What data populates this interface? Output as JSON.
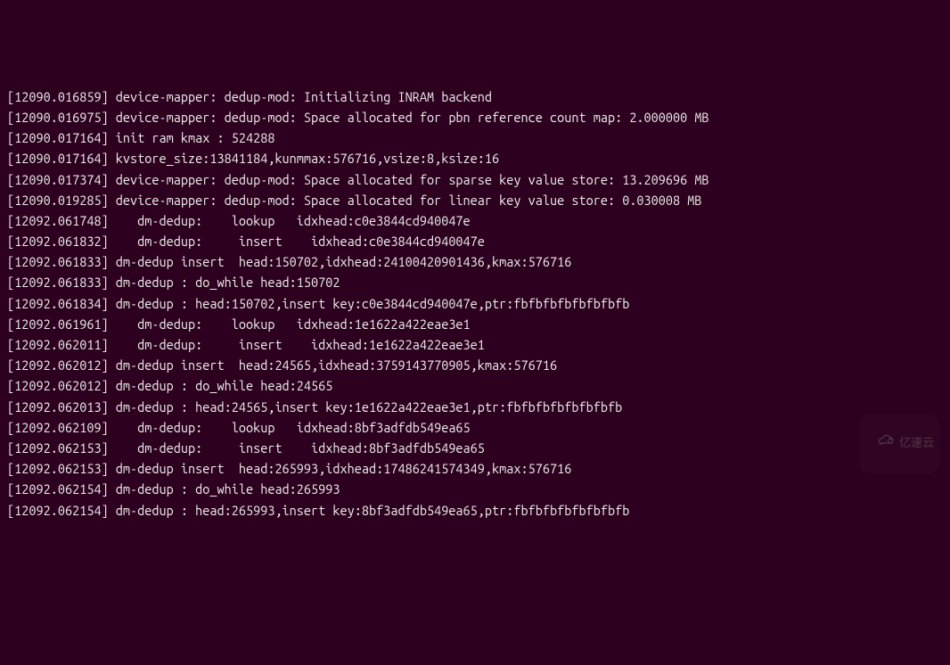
{
  "lines": [
    "[12090.016859] device-mapper: dedup-mod: Initializing INRAM backend",
    "[12090.016975] device-mapper: dedup-mod: Space allocated for pbn reference count map: 2.000000 MB",
    "",
    "[12090.017164] init ram kmax : 524288",
    "[12090.017164] kvstore_size:13841184,kunmmax:576716,vsize:8,ksize:16",
    "[12090.017374] device-mapper: dedup-mod: Space allocated for sparse key value store: 13.209696 MB",
    "",
    "[12090.019285] device-mapper: dedup-mod: Space allocated for linear key value store: 0.030008 MB",
    "",
    "[12092.061748]    dm-dedup:    lookup   idxhead:c0e3844cd940047e",
    "[12092.061832]    dm-dedup:     insert    idxhead:c0e3844cd940047e",
    "[12092.061833] dm-dedup insert  head:150702,idxhead:24100420901436,kmax:576716",
    "[12092.061833] dm-dedup : do_while head:150702",
    "[12092.061834] dm-dedup : head:150702,insert key:c0e3844cd940047e,ptr:fbfbfbfbfbfbfbfb",
    "[12092.061961]    dm-dedup:    lookup   idxhead:1e1622a422eae3e1",
    "[12092.062011]    dm-dedup:     insert    idxhead:1e1622a422eae3e1",
    "[12092.062012] dm-dedup insert  head:24565,idxhead:3759143770905,kmax:576716",
    "[12092.062012] dm-dedup : do_while head:24565",
    "[12092.062013] dm-dedup : head:24565,insert key:1e1622a422eae3e1,ptr:fbfbfbfbfbfbfbfb",
    "[12092.062109]    dm-dedup:    lookup   idxhead:8bf3adfdb549ea65",
    "[12092.062153]    dm-dedup:     insert    idxhead:8bf3adfdb549ea65",
    "[12092.062153] dm-dedup insert  head:265993,idxhead:17486241574349,kmax:576716",
    "[12092.062154] dm-dedup : do_while head:265993",
    "[12092.062154] dm-dedup : head:265993,insert key:8bf3adfdb549ea65,ptr:fbfbfbfbfbfbfbfb"
  ],
  "watermark": "亿速云"
}
